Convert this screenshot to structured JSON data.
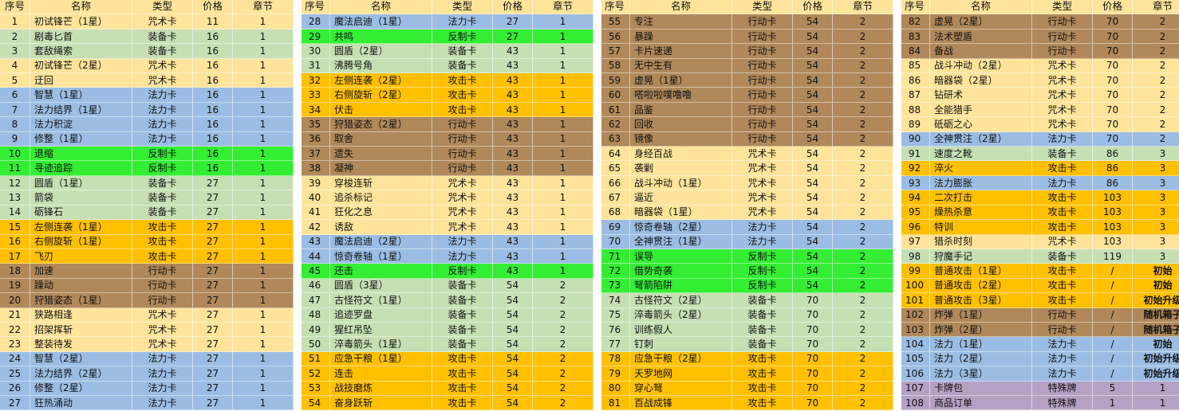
{
  "header": {
    "seq": "序号",
    "name": "名称",
    "type": "类型",
    "price": "价格",
    "chapter": "章节"
  },
  "colors": {
    "header": "#fde49a",
    "咒术卡": "#fde49a",
    "装备卡": "#c6e0b4",
    "法力卡": "#9bbde3",
    "反制卡": "#33ee33",
    "攻击卡": "#ffc000",
    "行动卡": "#b0885a",
    "特殊牌": "#b4a1c4"
  },
  "cards": [
    [
      "1",
      "初试锋芒（1星）",
      "咒术卡",
      "11",
      "1"
    ],
    [
      "2",
      "剧毒匕首",
      "装备卡",
      "16",
      "1"
    ],
    [
      "3",
      "套敌绳索",
      "装备卡",
      "16",
      "1"
    ],
    [
      "4",
      "初试锋芒（2星）",
      "咒术卡",
      "16",
      "1"
    ],
    [
      "5",
      "迂回",
      "咒术卡",
      "16",
      "1"
    ],
    [
      "6",
      "智慧（1星）",
      "法力卡",
      "16",
      "1"
    ],
    [
      "7",
      "法力结界（1星）",
      "法力卡",
      "16",
      "1"
    ],
    [
      "8",
      "法力积淀",
      "法力卡",
      "16",
      "1"
    ],
    [
      "9",
      "修整（1星）",
      "法力卡",
      "16",
      "1"
    ],
    [
      "10",
      "退缩",
      "反制卡",
      "16",
      "1"
    ],
    [
      "11",
      "寻迹追踪",
      "反制卡",
      "16",
      "1"
    ],
    [
      "12",
      "圆盾（1星）",
      "装备卡",
      "27",
      "1"
    ],
    [
      "13",
      "箭袋",
      "装备卡",
      "27",
      "1"
    ],
    [
      "14",
      "砺锋石",
      "装备卡",
      "27",
      "1"
    ],
    [
      "15",
      "左侧连袭（1星）",
      "攻击卡",
      "27",
      "1"
    ],
    [
      "16",
      "右侧旋斩（1星）",
      "攻击卡",
      "27",
      "1"
    ],
    [
      "17",
      "飞刃",
      "攻击卡",
      "27",
      "1"
    ],
    [
      "18",
      "加速",
      "行动卡",
      "27",
      "1"
    ],
    [
      "19",
      "躁动",
      "行动卡",
      "27",
      "1"
    ],
    [
      "20",
      "狩猎姿态（1星）",
      "行动卡",
      "27",
      "1"
    ],
    [
      "21",
      "狭路相逢",
      "咒术卡",
      "27",
      "1"
    ],
    [
      "22",
      "招架挥斩",
      "咒术卡",
      "27",
      "1"
    ],
    [
      "23",
      "整装待发",
      "咒术卡",
      "27",
      "1"
    ],
    [
      "24",
      "智慧（2星）",
      "法力卡",
      "27",
      "1"
    ],
    [
      "25",
      "法力结界（2星）",
      "法力卡",
      "27",
      "1"
    ],
    [
      "26",
      "修整（2星）",
      "法力卡",
      "27",
      "1"
    ],
    [
      "27",
      "狂热涌动",
      "法力卡",
      "27",
      "1"
    ],
    [
      "28",
      "魔法启迪（1星）",
      "法力卡",
      "27",
      "1"
    ],
    [
      "29",
      "共鸣",
      "反制卡",
      "27",
      "1"
    ],
    [
      "30",
      "圆盾（2星）",
      "装备卡",
      "43",
      "1"
    ],
    [
      "31",
      "沸腾号角",
      "装备卡",
      "43",
      "1"
    ],
    [
      "32",
      "左侧连袭（2星）",
      "攻击卡",
      "43",
      "1"
    ],
    [
      "33",
      "右侧旋斩（2星）",
      "攻击卡",
      "43",
      "1"
    ],
    [
      "34",
      "伏击",
      "攻击卡",
      "43",
      "1"
    ],
    [
      "35",
      "狩猎姿态（2星）",
      "行动卡",
      "43",
      "1"
    ],
    [
      "36",
      "取舍",
      "行动卡",
      "43",
      "1"
    ],
    [
      "37",
      "遗失",
      "行动卡",
      "43",
      "1"
    ],
    [
      "38",
      "凝神",
      "行动卡",
      "43",
      "1"
    ],
    [
      "39",
      "穿梭连斩",
      "咒术卡",
      "43",
      "1"
    ],
    [
      "40",
      "追杀标记",
      "咒术卡",
      "43",
      "1"
    ],
    [
      "41",
      "狂化之息",
      "咒术卡",
      "43",
      "1"
    ],
    [
      "42",
      "诱敌",
      "咒术卡",
      "43",
      "1"
    ],
    [
      "43",
      "魔法启迪（2星）",
      "法力卡",
      "43",
      "1"
    ],
    [
      "44",
      "惊奇卷轴（1星）",
      "法力卡",
      "43",
      "1"
    ],
    [
      "45",
      "还击",
      "反制卡",
      "43",
      "1"
    ],
    [
      "46",
      "圆盾（3星）",
      "装备卡",
      "54",
      "2"
    ],
    [
      "47",
      "古怪符文（1星）",
      "装备卡",
      "54",
      "2"
    ],
    [
      "48",
      "追迹罗盘",
      "装备卡",
      "54",
      "2"
    ],
    [
      "49",
      "猩红吊坠",
      "装备卡",
      "54",
      "2"
    ],
    [
      "50",
      "淬毒箭头（1星）",
      "装备卡",
      "54",
      "2"
    ],
    [
      "51",
      "应急干粮（1星）",
      "攻击卡",
      "54",
      "2"
    ],
    [
      "52",
      "连击",
      "攻击卡",
      "54",
      "2"
    ],
    [
      "53",
      "战技磨炼",
      "攻击卡",
      "54",
      "2"
    ],
    [
      "54",
      "奋身跃斩",
      "攻击卡",
      "54",
      "2"
    ],
    [
      "55",
      "专注",
      "行动卡",
      "54",
      "2"
    ],
    [
      "56",
      "暴躁",
      "行动卡",
      "54",
      "2"
    ],
    [
      "57",
      "卡片速递",
      "行动卡",
      "54",
      "2"
    ],
    [
      "58",
      "无中生有",
      "行动卡",
      "54",
      "2"
    ],
    [
      "59",
      "虚晃（1星）",
      "行动卡",
      "54",
      "2"
    ],
    [
      "60",
      "嗒啦啦噗噜噜",
      "行动卡",
      "54",
      "2"
    ],
    [
      "61",
      "品鉴",
      "行动卡",
      "54",
      "2"
    ],
    [
      "62",
      "回收",
      "行动卡",
      "54",
      "2"
    ],
    [
      "63",
      "镜像",
      "行动卡",
      "54",
      "2"
    ],
    [
      "64",
      "身经百战",
      "咒术卡",
      "54",
      "2"
    ],
    [
      "65",
      "袭剿",
      "咒术卡",
      "54",
      "2"
    ],
    [
      "66",
      "战斗冲动（1星）",
      "咒术卡",
      "54",
      "2"
    ],
    [
      "67",
      "逼近",
      "咒术卡",
      "54",
      "2"
    ],
    [
      "68",
      "暗器袋（1星）",
      "咒术卡",
      "54",
      "2"
    ],
    [
      "69",
      "惊奇卷轴（2星）",
      "法力卡",
      "54",
      "2"
    ],
    [
      "70",
      "全神贯注（1星）",
      "法力卡",
      "54",
      "2"
    ],
    [
      "71",
      "误导",
      "反制卡",
      "54",
      "2"
    ],
    [
      "72",
      "借势奇袭",
      "反制卡",
      "54",
      "2"
    ],
    [
      "73",
      "弩箭陷阱",
      "反制卡",
      "54",
      "2"
    ],
    [
      "74",
      "古怪符文（2星）",
      "装备卡",
      "70",
      "2"
    ],
    [
      "75",
      "淬毒箭头（2星）",
      "装备卡",
      "70",
      "2"
    ],
    [
      "76",
      "训练假人",
      "装备卡",
      "70",
      "2"
    ],
    [
      "77",
      "钉刺",
      "装备卡",
      "70",
      "2"
    ],
    [
      "78",
      "应急干粮（2星）",
      "攻击卡",
      "70",
      "2"
    ],
    [
      "79",
      "天罗地网",
      "攻击卡",
      "70",
      "2"
    ],
    [
      "80",
      "穿心弩",
      "攻击卡",
      "70",
      "2"
    ],
    [
      "81",
      "百战成锋",
      "攻击卡",
      "70",
      "2"
    ],
    [
      "82",
      "虚晃（2星）",
      "行动卡",
      "70",
      "2"
    ],
    [
      "83",
      "法术塑盾",
      "行动卡",
      "70",
      "2"
    ],
    [
      "84",
      "备战",
      "行动卡",
      "70",
      "2"
    ],
    [
      "85",
      "战斗冲动（2星）",
      "咒术卡",
      "70",
      "2"
    ],
    [
      "86",
      "暗器袋（2星）",
      "咒术卡",
      "70",
      "2"
    ],
    [
      "87",
      "钻研术",
      "咒术卡",
      "70",
      "2"
    ],
    [
      "88",
      "全能猎手",
      "咒术卡",
      "70",
      "2"
    ],
    [
      "89",
      "砥砺之心",
      "咒术卡",
      "70",
      "2"
    ],
    [
      "90",
      "全神贯注（2星）",
      "法力卡",
      "70",
      "2"
    ],
    [
      "91",
      "速度之靴",
      "装备卡",
      "86",
      "3"
    ],
    [
      "92",
      "淬火",
      "攻击卡",
      "86",
      "3"
    ],
    [
      "93",
      "法力膨胀",
      "法力卡",
      "86",
      "3"
    ],
    [
      "94",
      "二次打击",
      "攻击卡",
      "103",
      "3"
    ],
    [
      "95",
      "燥热杀意",
      "攻击卡",
      "103",
      "3"
    ],
    [
      "96",
      "特训",
      "攻击卡",
      "103",
      "3"
    ],
    [
      "97",
      "猎杀时刻",
      "咒术卡",
      "103",
      "3"
    ],
    [
      "98",
      "狩魔手记",
      "装备卡",
      "119",
      "3"
    ],
    [
      "99",
      "普通攻击（1星）",
      "攻击卡",
      "/",
      "初始"
    ],
    [
      "100",
      "普通攻击（2星）",
      "攻击卡",
      "/",
      "初始"
    ],
    [
      "101",
      "普通攻击（3星）",
      "攻击卡",
      "/",
      "初始升级"
    ],
    [
      "102",
      "炸弹（1星）",
      "行动卡",
      "/",
      "随机箱子"
    ],
    [
      "103",
      "炸弹（2星）",
      "行动卡",
      "/",
      "随机箱子"
    ],
    [
      "104",
      "法力（1星）",
      "法力卡",
      "/",
      "初始"
    ],
    [
      "105",
      "法力（2星）",
      "法力卡",
      "/",
      "初始升级"
    ],
    [
      "106",
      "法力（3星）",
      "法力卡",
      "/",
      "初始升级"
    ],
    [
      "107",
      "卡牌包",
      "特殊牌",
      "5",
      "1"
    ],
    [
      "108",
      "商品订单",
      "特殊牌",
      "1",
      "1"
    ]
  ]
}
